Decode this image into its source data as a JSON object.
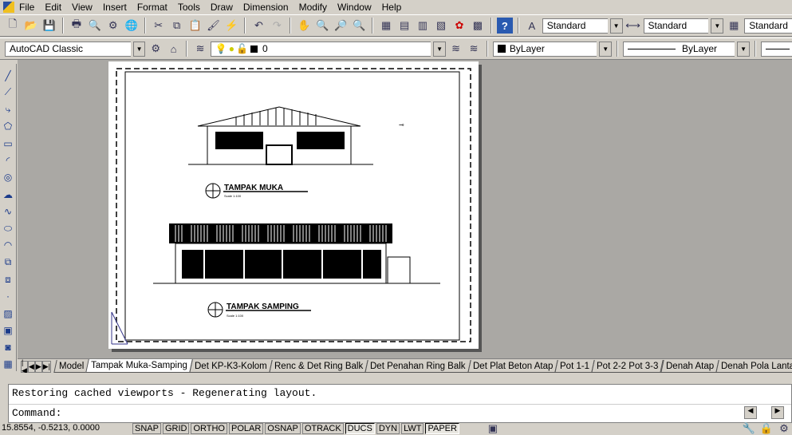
{
  "menu": [
    "File",
    "Edit",
    "View",
    "Insert",
    "Format",
    "Tools",
    "Draw",
    "Dimension",
    "Modify",
    "Window",
    "Help"
  ],
  "toolbar": {
    "text_style": "Standard",
    "dim_style": "Standard",
    "table_style": "Standard",
    "workspace": "AutoCAD Classic",
    "layer": "0",
    "color": "ByLayer",
    "linetype": "ByLayer"
  },
  "drawing": {
    "front_title": "TAMPAK MUKA",
    "front_scale": "Scale 1:100",
    "side_title": "TAMPAK SAMPING",
    "side_scale": "Scale 1:100"
  },
  "tabs": [
    "Model",
    "Tampak Muka-Samping",
    "Det KP-K3-Kolom",
    "Renc & Det Ring Balk",
    "Det Penahan Ring Balk",
    "Det Plat Beton Atap",
    "Pot 1-1",
    "Pot 2-2 Pot 3-3",
    "Denah Atap",
    "Denah Pola Lantai"
  ],
  "active_tab": "Tampak Muka-Samping",
  "command": {
    "history": "Restoring cached viewports - Regenerating layout.",
    "prompt": "Command:"
  },
  "status": {
    "coords": "15.8554, -0.5213, 0.0000",
    "toggles": [
      "SNAP",
      "GRID",
      "ORTHO",
      "POLAR",
      "OSNAP",
      "OTRACK",
      "DUCS",
      "DYN",
      "LWT",
      "PAPER"
    ],
    "active_toggles": [
      "DUCS",
      "PAPER"
    ]
  }
}
